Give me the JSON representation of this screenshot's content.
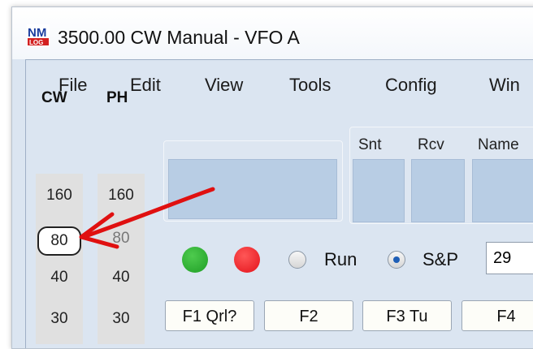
{
  "window": {
    "title": "3500.00 CW Manual - VFO A",
    "logo_icon": "n1mm-logo-icon"
  },
  "menu": [
    "File",
    "Edit",
    "View",
    "Tools",
    "Config",
    "Win"
  ],
  "bands": {
    "cw_header": "CW",
    "ph_header": "PH",
    "cw": [
      "160",
      "80",
      "40",
      "30"
    ],
    "ph": [
      "160",
      "80",
      "40",
      "30"
    ],
    "selected_cw": "80"
  },
  "log_columns": [
    "Snt",
    "Rcv",
    "Name"
  ],
  "mode": {
    "run_label": "Run",
    "sp_label": "S&P",
    "selected": "S&P",
    "rst_value": "29"
  },
  "function_keys": [
    "F1 Qrl?",
    "F2",
    "F3 Tu",
    "F4"
  ],
  "colors": {
    "window_bg": "#dbe5f1",
    "entry_field": "#b8cde4",
    "led_green": "#1f9e26",
    "led_red": "#e3121a",
    "annotation_arrow": "#e01010"
  },
  "annotation": "arrow pointing at 80m CW band button"
}
